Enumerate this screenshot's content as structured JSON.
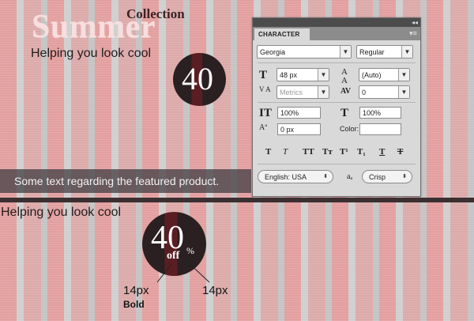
{
  "artwork": {
    "title_summer": "Summer",
    "title_collection": "Collection",
    "tagline": "Helping you look cool",
    "badge_number": "40",
    "product_text": "Some text regarding the featured product.",
    "tagline_bottom": "Helping you look cool",
    "badge_bottom_number": "40",
    "badge_bottom_off": "off",
    "badge_bottom_percent": "%",
    "annotation_left_size": "14px",
    "annotation_left_weight": "Bold",
    "annotation_right_size": "14px"
  },
  "colors": {
    "stripe_pink": "#e39f9f",
    "stripe_gray": "#cfcfcf",
    "badge_dark": "#2a2022",
    "badge_red": "#5a1e22",
    "divider": "#3b2f31"
  },
  "character_panel": {
    "collapse_glyph": "◂◂",
    "tab_label": "CHARACTER",
    "menu_glyph": "▾≡",
    "font_family": "Georgia",
    "font_style": "Regular",
    "font_size": "48 px",
    "leading": "(Auto)",
    "kerning": "Metrics",
    "tracking": "0",
    "vertical_scale": "100%",
    "horizontal_scale": "100%",
    "baseline_shift": "0 px",
    "color_label": "Color:",
    "style_buttons": [
      "T",
      "T",
      "TT",
      "Tт",
      "T¹",
      "T₁",
      "T",
      "T"
    ],
    "language": "English: USA",
    "antialias": "Crisp",
    "icons": [
      "font-size-icon",
      "leading-icon",
      "kerning-icon",
      "tracking-icon",
      "vertical-scale-icon",
      "horizontal-scale-icon",
      "baseline-shift-icon",
      "antialias-icon"
    ]
  }
}
